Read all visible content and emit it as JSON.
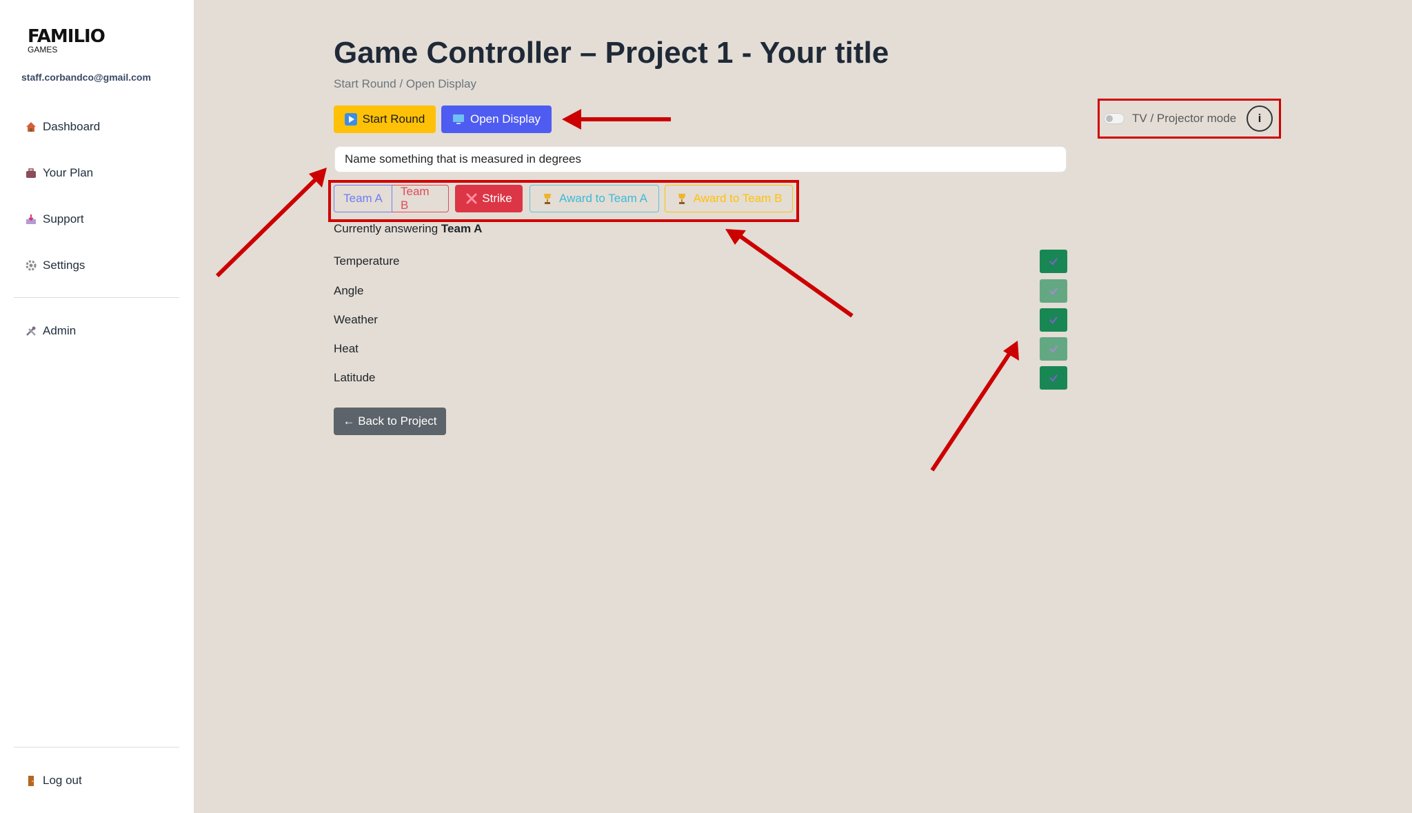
{
  "sidebar": {
    "logo": "FAMILIO",
    "logo_sub": "GAMES",
    "email": "staff.corbandco@gmail.com",
    "items": [
      {
        "label": "Dashboard",
        "icon": "house-icon"
      },
      {
        "label": "Your Plan",
        "icon": "briefcase-icon"
      },
      {
        "label": "Support",
        "icon": "inbox-icon"
      },
      {
        "label": "Settings",
        "icon": "gear-icon"
      },
      {
        "label": "Admin",
        "icon": "tools-icon"
      }
    ],
    "logout": "Log out"
  },
  "header": {
    "title": "Game Controller – Project 1 - Your title",
    "subtitle": "Start Round / Open Display"
  },
  "toolbar": {
    "start_label": "Start Round",
    "display_label": "Open Display"
  },
  "question": "Name something that is measured in degrees",
  "controls": {
    "team_a": "Team A",
    "team_b": "Team B",
    "strike": "Strike",
    "award_a": "Award to Team A",
    "award_b": "Award to Team B"
  },
  "answering": {
    "prefix": "Currently answering",
    "team": "Team A"
  },
  "answers": [
    {
      "text": "Temperature",
      "revealed": true
    },
    {
      "text": "Angle",
      "revealed": false
    },
    {
      "text": "Weather",
      "revealed": true
    },
    {
      "text": "Heat",
      "revealed": false
    },
    {
      "text": "Latitude",
      "revealed": true
    }
  ],
  "back_label": "← Back to Project",
  "tv_mode": {
    "label": "TV / Projector mode",
    "info": "i",
    "enabled": false
  },
  "colors": {
    "start": "#ffc107",
    "display": "#4f5cf1",
    "strike": "#dc3545",
    "check_dark": "#198754",
    "check_light": "#63a883",
    "annotation": "#d00000"
  }
}
